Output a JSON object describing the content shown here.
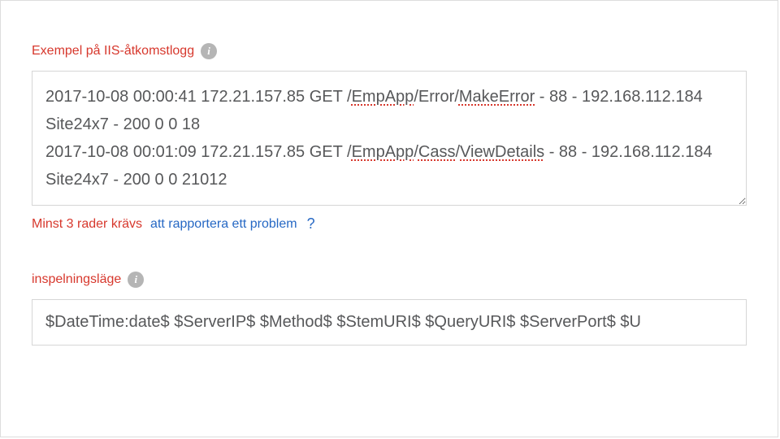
{
  "section1": {
    "label": "Exempel på IIS-åtkomstlogg",
    "log_line1_prefix": "2017-10-08 00:00:41 172.21.157.85 GET /",
    "log_line1_seg1": "EmpApp",
    "log_line1_mid1": "/Error/",
    "log_line1_seg2": "MakeError",
    "log_line1_suffix": " - 88 - 192.168.112.184 Site24x7 - 200 0 0 18",
    "log_line2_prefix": "2017-10-08 00:01:09 172.21.157.85 GET /",
    "log_line2_seg1": "EmpApp",
    "log_line2_mid1": "/",
    "log_line2_seg2": "Cass",
    "log_line2_mid2": "/",
    "log_line2_seg3": "ViewDetails",
    "log_line2_suffix": " - 88 - 192.168.112.184 Site24x7 - 200 0 0 21012"
  },
  "validation": {
    "message": "Minst 3 rader krävs",
    "report_link": "att rapportera ett problem",
    "help_symbol": "?"
  },
  "section2": {
    "label": "inspelningsläge",
    "pattern_value": "$DateTime:date$ $ServerIP$ $Method$ $StemURI$ $QueryURI$ $ServerPort$ $U"
  },
  "icons": {
    "info_glyph": "i"
  }
}
